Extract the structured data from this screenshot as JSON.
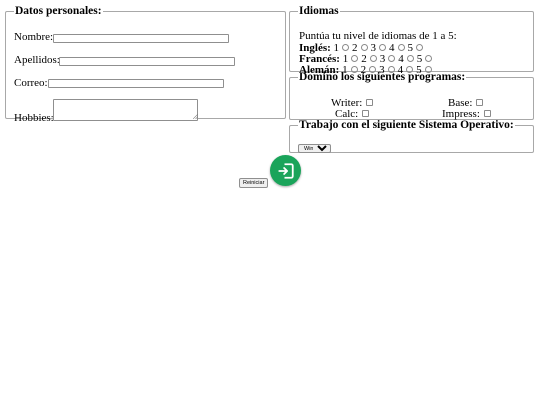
{
  "personal": {
    "legend": "Datos personales:",
    "nombre_label": "Nombre:",
    "apellidos_label": "Apellidos:",
    "correo_label": "Correo:",
    "hobbies_label": "Hobbies:"
  },
  "idiomas": {
    "legend": "Idiomas",
    "intro": "Puntúa tu nivel de idiomas de 1 a 5:",
    "languages": [
      {
        "name": "Inglés:",
        "levels": [
          "1",
          "2",
          "3",
          "4",
          "5"
        ]
      },
      {
        "name": "Francés:",
        "levels": [
          "1",
          "2",
          "3",
          "4",
          "5"
        ]
      },
      {
        "name": "Alemán:",
        "levels": [
          "1",
          "2",
          "3",
          "4",
          "5"
        ]
      }
    ]
  },
  "programs": {
    "legend": "Domino los siguientes programas:",
    "items": [
      "Writer:",
      "Base:",
      "Calc:",
      "Impress:"
    ]
  },
  "os": {
    "legend": "Trabajo con el siguiente Sistema Operativo:",
    "selected": "Windows"
  },
  "actions": {
    "reset_label": "Reiniciar"
  },
  "colors": {
    "fab": "#1aa45a"
  },
  "icons": {
    "fab": "login-icon"
  }
}
